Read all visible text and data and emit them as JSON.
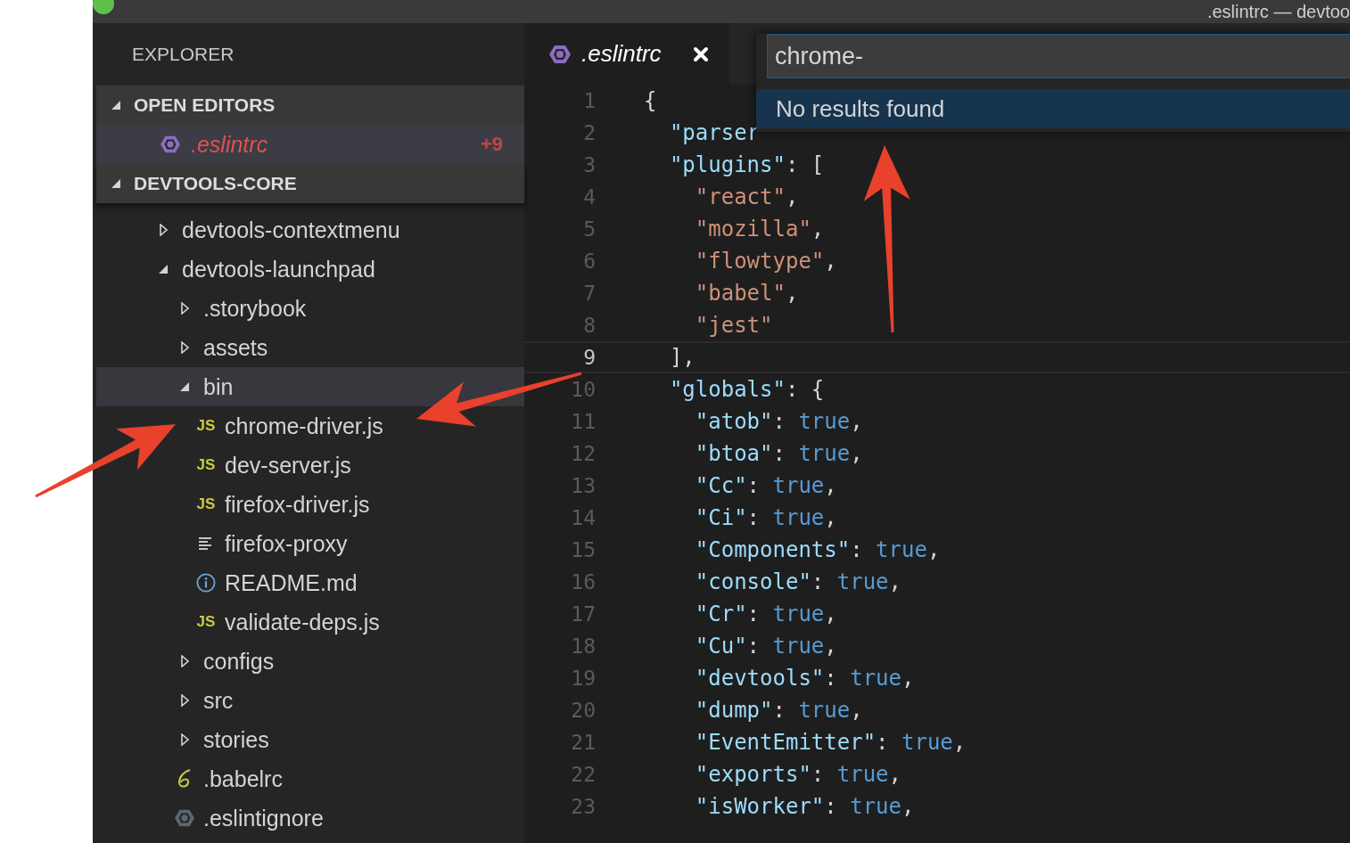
{
  "window": {
    "title": ".eslintrc — devtoo"
  },
  "sidebar": {
    "title": "EXPLORER",
    "open_editors": {
      "label": "OPEN EDITORS",
      "expanded": true,
      "items": [
        {
          "label": ".eslintrc",
          "kind": "eslint",
          "badge": "+9",
          "selected": true
        }
      ]
    },
    "project": {
      "label": "DEVTOOLS-CORE",
      "expanded": true,
      "tree": [
        {
          "label": "devtools-contextmenu",
          "kind": "folder",
          "expanded": false,
          "selected": false
        },
        {
          "label": "devtools-launchpad",
          "kind": "folder",
          "expanded": true,
          "selected": false,
          "children": [
            {
              "label": ".storybook",
              "kind": "folder",
              "expanded": false,
              "selected": false
            },
            {
              "label": "assets",
              "kind": "folder",
              "expanded": false,
              "selected": false
            },
            {
              "label": "bin",
              "kind": "folder",
              "expanded": true,
              "selected": true,
              "children": [
                {
                  "label": "chrome-driver.js",
                  "kind": "js",
                  "icon_text": "JS",
                  "selected": false
                },
                {
                  "label": "dev-server.js",
                  "kind": "js",
                  "icon_text": "JS",
                  "selected": false
                },
                {
                  "label": "firefox-driver.js",
                  "kind": "js",
                  "icon_text": "JS",
                  "selected": false
                },
                {
                  "label": "firefox-proxy",
                  "kind": "text",
                  "selected": false
                },
                {
                  "label": "README.md",
                  "kind": "info",
                  "selected": false
                },
                {
                  "label": "validate-deps.js",
                  "kind": "js",
                  "icon_text": "JS",
                  "selected": false
                }
              ]
            },
            {
              "label": "configs",
              "kind": "folder",
              "expanded": false,
              "selected": false
            },
            {
              "label": "src",
              "kind": "folder",
              "expanded": false,
              "selected": false
            },
            {
              "label": "stories",
              "kind": "folder",
              "expanded": false,
              "selected": false
            },
            {
              "label": ".babelrc",
              "kind": "babel",
              "selected": false
            },
            {
              "label": ".eslintignore",
              "kind": "eslint-muted",
              "selected": false
            }
          ]
        }
      ]
    }
  },
  "tabs": [
    {
      "label": ".eslintrc",
      "selected": true
    }
  ],
  "quick_open": {
    "value": "chrome-",
    "results": [
      {
        "label": "No results found",
        "selected": true
      }
    ]
  },
  "editor": {
    "lines": [
      {
        "number": "1",
        "current": false,
        "tokens": [
          {
            "kind": "punct",
            "text": "{"
          }
        ]
      },
      {
        "number": "2",
        "current": false,
        "tokens": [
          {
            "kind": "key",
            "text": "  \"parser"
          }
        ]
      },
      {
        "number": "3",
        "current": false,
        "tokens": [
          {
            "kind": "key",
            "text": "  \"plugins\""
          },
          {
            "kind": "punct",
            "text": ": ["
          }
        ]
      },
      {
        "number": "4",
        "current": false,
        "tokens": [
          {
            "kind": "string",
            "text": "    \"react\""
          },
          {
            "kind": "punct",
            "text": ","
          }
        ]
      },
      {
        "number": "5",
        "current": false,
        "tokens": [
          {
            "kind": "string",
            "text": "    \"mozilla\""
          },
          {
            "kind": "punct",
            "text": ","
          }
        ]
      },
      {
        "number": "6",
        "current": false,
        "tokens": [
          {
            "kind": "string",
            "text": "    \"flowtype\""
          },
          {
            "kind": "punct",
            "text": ","
          }
        ]
      },
      {
        "number": "7",
        "current": false,
        "tokens": [
          {
            "kind": "string",
            "text": "    \"babel\""
          },
          {
            "kind": "punct",
            "text": ","
          }
        ]
      },
      {
        "number": "8",
        "current": false,
        "tokens": [
          {
            "kind": "string",
            "text": "    \"jest\""
          }
        ]
      },
      {
        "number": "9",
        "current": true,
        "tokens": [
          {
            "kind": "punct",
            "text": "  ],"
          }
        ]
      },
      {
        "number": "10",
        "current": false,
        "tokens": [
          {
            "kind": "key",
            "text": "  \"globals\""
          },
          {
            "kind": "punct",
            "text": ": {"
          }
        ]
      },
      {
        "number": "11",
        "current": false,
        "tokens": [
          {
            "kind": "key",
            "text": "    \"atob\""
          },
          {
            "kind": "punct",
            "text": ": "
          },
          {
            "kind": "bool",
            "text": "true"
          },
          {
            "kind": "punct",
            "text": ","
          }
        ]
      },
      {
        "number": "12",
        "current": false,
        "tokens": [
          {
            "kind": "key",
            "text": "    \"btoa\""
          },
          {
            "kind": "punct",
            "text": ": "
          },
          {
            "kind": "bool",
            "text": "true"
          },
          {
            "kind": "punct",
            "text": ","
          }
        ]
      },
      {
        "number": "13",
        "current": false,
        "tokens": [
          {
            "kind": "key",
            "text": "    \"Cc\""
          },
          {
            "kind": "punct",
            "text": ": "
          },
          {
            "kind": "bool",
            "text": "true"
          },
          {
            "kind": "punct",
            "text": ","
          }
        ]
      },
      {
        "number": "14",
        "current": false,
        "tokens": [
          {
            "kind": "key",
            "text": "    \"Ci\""
          },
          {
            "kind": "punct",
            "text": ": "
          },
          {
            "kind": "bool",
            "text": "true"
          },
          {
            "kind": "punct",
            "text": ","
          }
        ]
      },
      {
        "number": "15",
        "current": false,
        "tokens": [
          {
            "kind": "key",
            "text": "    \"Components\""
          },
          {
            "kind": "punct",
            "text": ": "
          },
          {
            "kind": "bool",
            "text": "true"
          },
          {
            "kind": "punct",
            "text": ","
          }
        ]
      },
      {
        "number": "16",
        "current": false,
        "tokens": [
          {
            "kind": "key",
            "text": "    \"console\""
          },
          {
            "kind": "punct",
            "text": ": "
          },
          {
            "kind": "bool",
            "text": "true"
          },
          {
            "kind": "punct",
            "text": ","
          }
        ]
      },
      {
        "number": "17",
        "current": false,
        "tokens": [
          {
            "kind": "key",
            "text": "    \"Cr\""
          },
          {
            "kind": "punct",
            "text": ": "
          },
          {
            "kind": "bool",
            "text": "true"
          },
          {
            "kind": "punct",
            "text": ","
          }
        ]
      },
      {
        "number": "18",
        "current": false,
        "tokens": [
          {
            "kind": "key",
            "text": "    \"Cu\""
          },
          {
            "kind": "punct",
            "text": ": "
          },
          {
            "kind": "bool",
            "text": "true"
          },
          {
            "kind": "punct",
            "text": ","
          }
        ]
      },
      {
        "number": "19",
        "current": false,
        "tokens": [
          {
            "kind": "key",
            "text": "    \"devtools\""
          },
          {
            "kind": "punct",
            "text": ": "
          },
          {
            "kind": "bool",
            "text": "true"
          },
          {
            "kind": "punct",
            "text": ","
          }
        ]
      },
      {
        "number": "20",
        "current": false,
        "tokens": [
          {
            "kind": "key",
            "text": "    \"dump\""
          },
          {
            "kind": "punct",
            "text": ": "
          },
          {
            "kind": "bool",
            "text": "true"
          },
          {
            "kind": "punct",
            "text": ","
          }
        ]
      },
      {
        "number": "21",
        "current": false,
        "tokens": [
          {
            "kind": "key",
            "text": "    \"EventEmitter\""
          },
          {
            "kind": "punct",
            "text": ": "
          },
          {
            "kind": "bool",
            "text": "true"
          },
          {
            "kind": "punct",
            "text": ","
          }
        ]
      },
      {
        "number": "22",
        "current": false,
        "tokens": [
          {
            "kind": "key",
            "text": "    \"exports\""
          },
          {
            "kind": "punct",
            "text": ": "
          },
          {
            "kind": "bool",
            "text": "true"
          },
          {
            "kind": "punct",
            "text": ","
          }
        ]
      },
      {
        "number": "23",
        "current": false,
        "tokens": [
          {
            "kind": "key",
            "text": "    \"isWorker\""
          },
          {
            "kind": "punct",
            "text": ": "
          },
          {
            "kind": "bool",
            "text": "true"
          },
          {
            "kind": "punct",
            "text": ","
          }
        ]
      }
    ]
  }
}
